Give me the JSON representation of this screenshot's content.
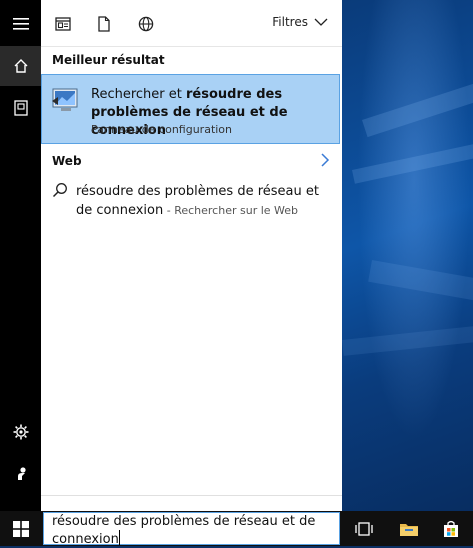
{
  "panel": {
    "filters_label": "Filtres",
    "best_heading": "Meilleur résultat",
    "best_result": {
      "title_prefix": "Rechercher et ",
      "title_bold": "résoudre des problèmes de réseau et de connexion",
      "subtitle": "Panneau de configuration"
    },
    "web_heading": "Web",
    "web_suggestion": {
      "query": "résoudre des problèmes de réseau et de connexion",
      "source": " - Rechercher sur le Web"
    }
  },
  "search": {
    "value": "résoudre des problèmes de réseau et de connexion"
  },
  "icons": {
    "rail": [
      "hamburger-icon",
      "home-icon",
      "notebook-icon",
      "settings-icon",
      "feedback-icon"
    ],
    "toolbar": [
      "apps-icon",
      "document-icon",
      "web-icon"
    ],
    "taskbar": [
      "windows-start-icon",
      "task-view-icon",
      "file-explorer-icon",
      "store-icon"
    ]
  },
  "colors": {
    "selection": "#a9d1f5",
    "selection_border": "#5aa2e3",
    "rail": "#000000",
    "taskbar": "#101010"
  }
}
